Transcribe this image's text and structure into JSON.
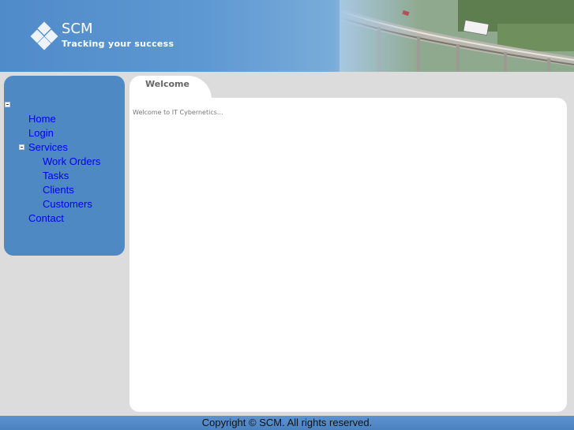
{
  "header": {
    "brand": "SCM",
    "tagline": "Tracking your success",
    "colors": {
      "sky": "#5e98d2",
      "accent": "#4e89c4"
    }
  },
  "sidebar": {
    "items": [
      {
        "label": "Home"
      },
      {
        "label": "Login"
      },
      {
        "label": "Services",
        "children": [
          {
            "label": "Work Orders"
          },
          {
            "label": "Tasks"
          },
          {
            "label": "Clients"
          },
          {
            "label": "Customers"
          }
        ]
      },
      {
        "label": "Contact"
      }
    ]
  },
  "content": {
    "tab_label": "Welcome",
    "welcome_text": "Welcome to IT Cybernetics..."
  },
  "footer": {
    "copyright": "Copyright © SCM. All rights reserved."
  }
}
